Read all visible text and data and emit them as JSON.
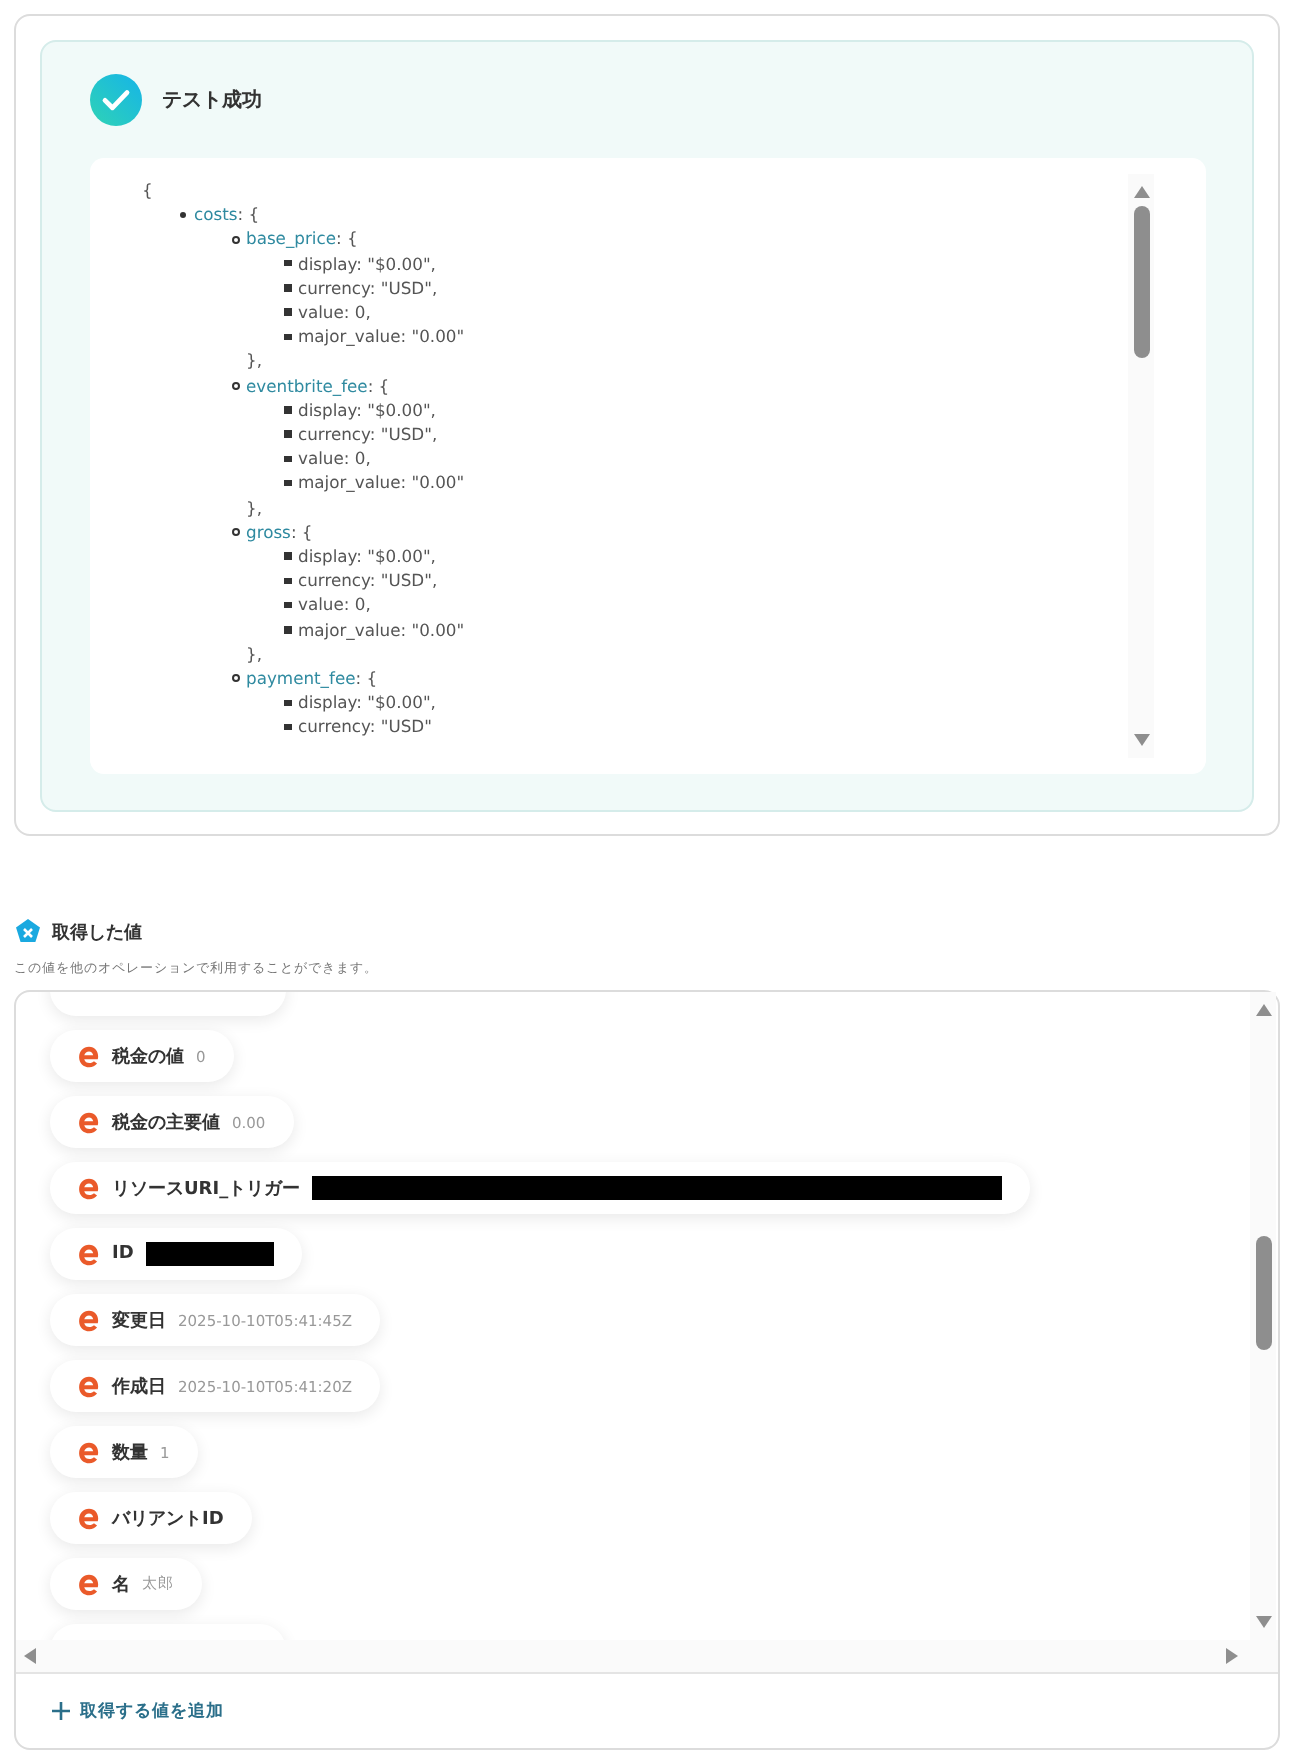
{
  "test_result": {
    "kind": "success",
    "title": "テスト成功",
    "code": {
      "open": "{",
      "entries": [
        {
          "key": "costs",
          "rest": ": {",
          "children": [
            {
              "key": "base_price",
              "rest": ": {",
              "children": [
                {
                  "text": "display: \"$0.00\","
                },
                {
                  "text": "currency: \"USD\","
                },
                {
                  "text": "value: 0,"
                },
                {
                  "text": "major_value: \"0.00\""
                }
              ],
              "close": "},"
            },
            {
              "key": "eventbrite_fee",
              "rest": ": {",
              "children": [
                {
                  "text": "display: \"$0.00\","
                },
                {
                  "text": "currency: \"USD\","
                },
                {
                  "text": "value: 0,"
                },
                {
                  "text": "major_value: \"0.00\""
                }
              ],
              "close": "},"
            },
            {
              "key": "gross",
              "rest": ": {",
              "children": [
                {
                  "text": "display: \"$0.00\","
                },
                {
                  "text": "currency: \"USD\","
                },
                {
                  "text": "value: 0,"
                },
                {
                  "text": "major_value: \"0.00\""
                }
              ],
              "close": "},"
            },
            {
              "key": "payment_fee",
              "rest": ": {",
              "children": [
                {
                  "text": "display: \"$0.00\","
                },
                {
                  "text": "currency: \"USD\""
                }
              ]
            }
          ]
        }
      ]
    }
  },
  "values_section": {
    "title": "取得した値",
    "description": "この値を他のオペレーションで利用することができます。",
    "items": [
      {
        "kind": "clipped"
      },
      {
        "label": "税金の値",
        "value": "0",
        "kind": "text"
      },
      {
        "label": "税金の主要値",
        "value": "0.00",
        "kind": "text"
      },
      {
        "label": "リソースURI_トリガー",
        "kind": "redacted_long"
      },
      {
        "label": "ID",
        "kind": "redacted_short"
      },
      {
        "label": "変更日",
        "value": "2025-10-10T05:41:45Z",
        "kind": "text"
      },
      {
        "label": "作成日",
        "value": "2025-10-10T05:41:20Z",
        "kind": "text"
      },
      {
        "label": "数量",
        "value": "1",
        "kind": "text"
      },
      {
        "label": "バリアントID",
        "kind": "plain"
      },
      {
        "label": "名",
        "value": "太郎",
        "kind": "text"
      },
      {
        "kind": "clipped"
      }
    ],
    "add_button": "取得する値を追加"
  }
}
